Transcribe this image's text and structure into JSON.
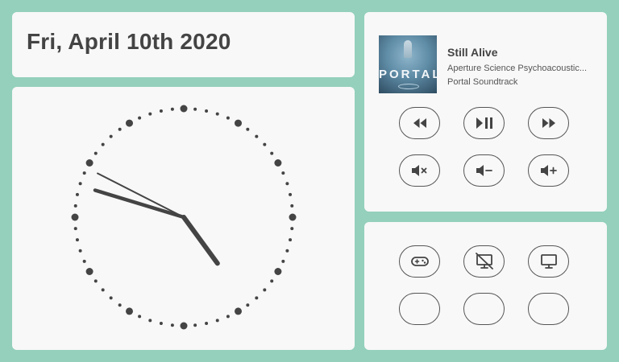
{
  "date": {
    "text": "Fri, April 10th 2020"
  },
  "clock": {
    "hour": 16,
    "minute": 47,
    "second": 49.5
  },
  "media": {
    "album_art_logo": "PORTAL",
    "title": "Still Alive",
    "artist": "Aperture Science Psychoacoustic...",
    "album": "Portal Soundtrack",
    "buttons": [
      {
        "icon": "rewind-icon",
        "label": "Rewind"
      },
      {
        "icon": "play-pause-icon",
        "label": "Play/Pause"
      },
      {
        "icon": "fast-forward-icon",
        "label": "Fast forward"
      },
      {
        "icon": "volume-mute-icon",
        "label": "Mute"
      },
      {
        "icon": "volume-down-icon",
        "label": "Volume down"
      },
      {
        "icon": "volume-up-icon",
        "label": "Volume up"
      }
    ]
  },
  "controls": {
    "buttons": [
      {
        "icon": "gamepad-icon",
        "label": "Game mode"
      },
      {
        "icon": "monitor-off-icon",
        "label": "Display off"
      },
      {
        "icon": "monitor-icon",
        "label": "Display"
      },
      {
        "icon": "",
        "label": ""
      },
      {
        "icon": "",
        "label": ""
      },
      {
        "icon": "",
        "label": ""
      }
    ]
  },
  "colors": {
    "background": "#94d0bb",
    "card": "#f8f8f8",
    "ink": "#444444"
  }
}
